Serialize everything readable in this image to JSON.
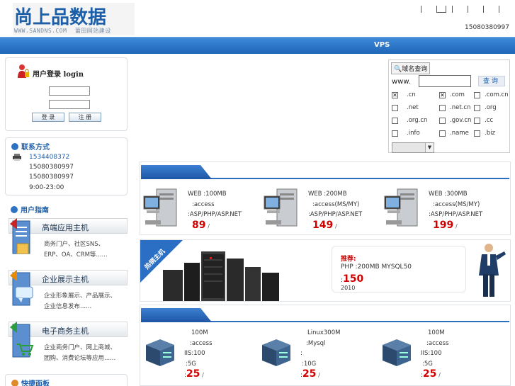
{
  "header": {
    "logo_text": "尚上品数据",
    "logo_sub_left": "WWW.SANDNS.COM",
    "logo_sub_right": "莆田网站建设",
    "phone": "15080380997"
  },
  "navbar": {
    "vps_label": "VPS"
  },
  "login": {
    "title": "用户登录 login",
    "login_btn": "登 录",
    "register_btn": "注 册"
  },
  "contact": {
    "title": "联系方式",
    "lines": [
      "1534408372",
      "15080380997",
      "15080380997",
      "9:00-23:00"
    ]
  },
  "guide": {
    "title": "用户指南",
    "cards": [
      {
        "title": "高端应用主机",
        "desc": [
          "商务门户、社区SNS、",
          "ERP、OA、CRM等......"
        ]
      },
      {
        "title": "企业展示主机",
        "desc": [
          "企业形象展示、产品展示、",
          "企业信息发布......"
        ]
      },
      {
        "title": "电子商务主机",
        "desc": [
          "企业商务门户、网上商城、",
          "团购、消费论坛等应用......"
        ]
      }
    ]
  },
  "fast": {
    "title": "快捷面板"
  },
  "domain": {
    "tab_label": "域名查询",
    "www_label": "www.",
    "query_btn": "查询",
    "options": [
      {
        "label": ".cn",
        "checked": true
      },
      {
        "label": ".com",
        "checked": true
      },
      {
        "label": ".com.cn",
        "checked": false
      },
      {
        "label": ".net",
        "checked": false
      },
      {
        "label": ".net.cn",
        "checked": false
      },
      {
        "label": ".org",
        "checked": false
      },
      {
        "label": ".org.cn",
        "checked": false
      },
      {
        "label": ".gov.cn",
        "checked": false
      },
      {
        "label": ".cc",
        "checked": false
      },
      {
        "label": ".info",
        "checked": false
      },
      {
        "label": ".name",
        "checked": false
      },
      {
        "label": ".biz",
        "checked": false
      }
    ]
  },
  "web_products": [
    {
      "l1": "WEB :100MB",
      "l2": ":access",
      "l3": ":ASP/PHP/ASP.NET",
      "price": "89",
      "unit": "/"
    },
    {
      "l1": "WEB :200MB",
      "l2": ":access(MS/MY)",
      "l3": ":ASP/PHP/ASP.NET",
      "price": "149",
      "unit": "/"
    },
    {
      "l1": "WEB :300MB",
      "l2": ":access(MS/MY)",
      "l3": ":ASP/PHP/ASP.NET",
      "price": "199",
      "unit": "/"
    }
  ],
  "hot": {
    "badge": "热销主机",
    "rec_title": "推荐:",
    "rec_line": "PHP :200MB MYSQL50",
    "rec_price_prefix": ":",
    "rec_price": "150",
    "rec_year": "2010"
  },
  "vps_products": [
    {
      "l1": "100M",
      "l2": ":access",
      "l3": "IIS:100",
      "l4": ":5G",
      "price_prefix": ":",
      "price": "25",
      "unit": "/"
    },
    {
      "l1": "Linux300M",
      "l2": ":Mysql",
      "l3": ":",
      "l4": ":10G",
      "price_prefix": ":",
      "price": "25",
      "unit": "/"
    },
    {
      "l1": "100M",
      "l2": ":access",
      "l3": "IIS:100",
      "l4": ":5G",
      "price_prefix": ":",
      "price": "25",
      "unit": "/"
    }
  ]
}
